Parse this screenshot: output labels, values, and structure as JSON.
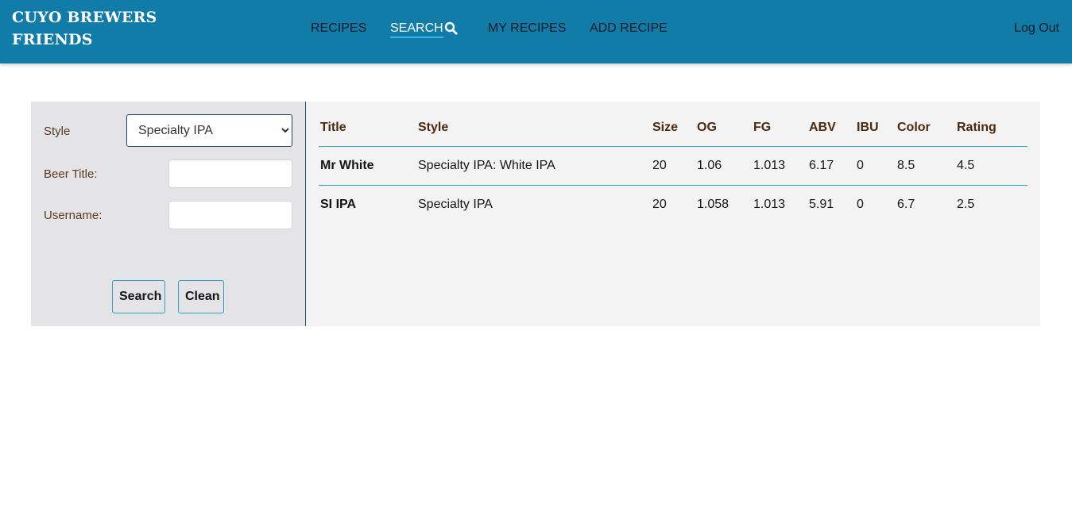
{
  "brand": "CUYO BREWERS FRIENDS",
  "nav": {
    "recipes": "RECIPES",
    "search": "SEARCH",
    "my_recipes": "MY RECIPES",
    "add_recipe": "ADD RECIPE",
    "logout": "Log Out"
  },
  "filters": {
    "style_label": "Style",
    "style_selected": "Specialty IPA",
    "beer_title_label": "Beer Title:",
    "beer_title_value": "",
    "username_label": "Username:",
    "username_value": "",
    "search_button": "Search",
    "clean_button": "Clean"
  },
  "table": {
    "headers": [
      "Title",
      "Style",
      "Size",
      "OG",
      "FG",
      "ABV",
      "IBU",
      "Color",
      "Rating"
    ],
    "rows": [
      [
        "Mr White",
        "Specialty IPA: White IPA",
        "20",
        "1.06",
        "1.013",
        "6.17",
        "0",
        "8.5",
        "4.5"
      ],
      [
        "SI IPA",
        "Specialty IPA",
        "20",
        "1.058",
        "1.013",
        "5.91",
        "0",
        "6.7",
        "2.5"
      ]
    ]
  },
  "colors": {
    "navbar": "#117ca8",
    "accent": "#2a9fd0"
  }
}
